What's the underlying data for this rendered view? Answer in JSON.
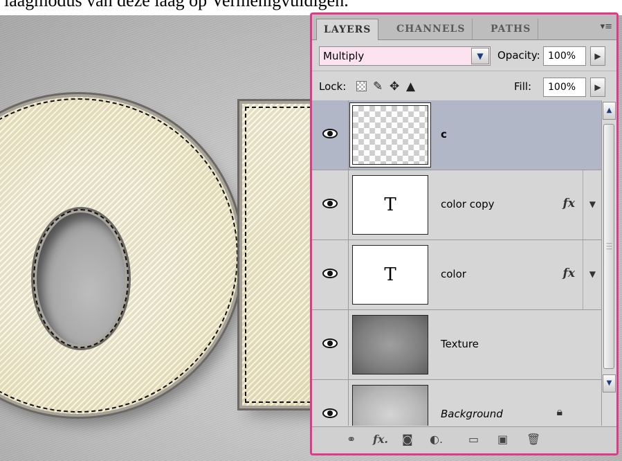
{
  "caption": "laagmodus van deze laag op Vermenigvuldigen.",
  "panel": {
    "tabs": [
      {
        "label": "LAYERS",
        "active": true
      },
      {
        "label": "CHANNELS",
        "active": false
      },
      {
        "label": "PATHS",
        "active": false
      }
    ],
    "menu_icon": "panel-menu-icon",
    "blend_mode": "Multiply",
    "opacity_label": "Opacity:",
    "opacity_value": "100%",
    "lock_label": "Lock:",
    "lock_icons": [
      "lock-transparent-pixels-icon",
      "lock-image-pixels-icon",
      "lock-position-icon",
      "lock-all-icon"
    ],
    "fill_label": "Fill:",
    "fill_value": "100%",
    "accent_color": "#e0398a",
    "selected_layer_color": "#b1b7c7",
    "layers": [
      {
        "name": "c",
        "thumb": "transparent",
        "selected": true,
        "fx": false
      },
      {
        "name": "color copy",
        "thumb": "text",
        "thumb_text": "T",
        "selected": false,
        "fx": true,
        "fx_label": "fx"
      },
      {
        "name": "color",
        "thumb": "text",
        "thumb_text": "T",
        "selected": false,
        "fx": true,
        "fx_label": "fx"
      },
      {
        "name": "Texture",
        "thumb": "texture",
        "selected": false,
        "fx": false
      },
      {
        "name": "Background",
        "thumb": "background",
        "selected": false,
        "fx": false,
        "locked": true
      }
    ],
    "bottom_icons": [
      "link-layers-icon",
      "add-layer-style-icon",
      "add-mask-icon",
      "new-adjustment-layer-icon",
      "new-group-icon",
      "new-layer-icon",
      "delete-layer-icon"
    ]
  }
}
